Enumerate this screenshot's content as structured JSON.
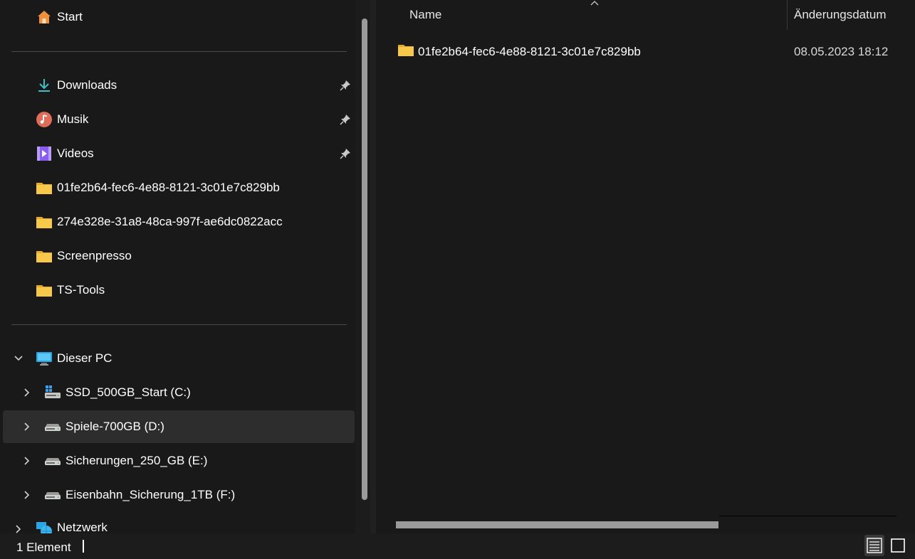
{
  "nav": {
    "start": "Start",
    "quick_access": [
      {
        "label": "Downloads",
        "icon": "download-icon",
        "pinned": true
      },
      {
        "label": "Musik",
        "icon": "music-icon",
        "pinned": true
      },
      {
        "label": "Videos",
        "icon": "video-icon",
        "pinned": true
      },
      {
        "label": "01fe2b64-fec6-4e88-8121-3c01e7c829bb",
        "icon": "folder-icon",
        "pinned": false
      },
      {
        "label": "274e328e-31a8-48ca-997f-ae6dc0822acc",
        "icon": "folder-icon",
        "pinned": false
      },
      {
        "label": "Screenpresso",
        "icon": "folder-icon",
        "pinned": false
      },
      {
        "label": "TS-Tools",
        "icon": "folder-icon",
        "pinned": false
      }
    ],
    "this_pc": "Dieser PC",
    "drives": [
      {
        "label": "SSD_500GB_Start (C:)",
        "icon": "system-drive-icon"
      },
      {
        "label": "Spiele-700GB (D:)",
        "icon": "drive-icon",
        "selected": true
      },
      {
        "label": "Sicherungen_250_GB (E:)",
        "icon": "drive-icon"
      },
      {
        "label": "Eisenbahn_Sicherung_1TB (F:)",
        "icon": "drive-icon"
      }
    ],
    "network": "Netzwerk"
  },
  "list": {
    "columns": {
      "name": "Name",
      "modified": "Änderungsdatum"
    },
    "rows": [
      {
        "name": "01fe2b64-fec6-4e88-8121-3c01e7c829bb",
        "modified": "08.05.2023 18:12"
      }
    ]
  },
  "status": {
    "count": "1 Element"
  },
  "colors": {
    "folder": "#f8c84a",
    "accent": "#3cc0c8",
    "selected": "#2d2d2d"
  }
}
